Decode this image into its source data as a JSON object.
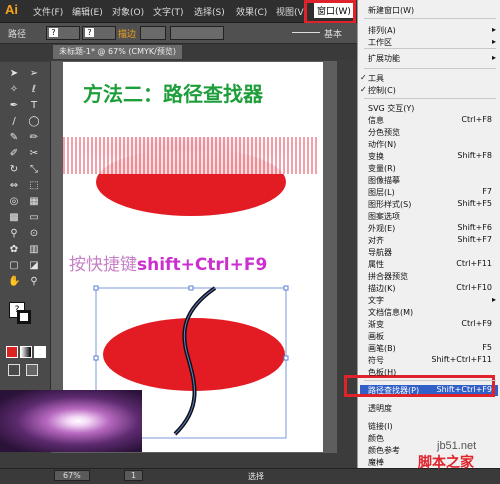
{
  "app": {
    "logo": "Ai"
  },
  "menubar": {
    "items": [
      "文件(F)",
      "编辑(E)",
      "对象(O)",
      "文字(T)",
      "选择(S)",
      "效果(C)",
      "视图(V)",
      "窗口(W)"
    ],
    "active": "窗口(W)"
  },
  "control": {
    "label": "路径",
    "stroke_label": "描边",
    "basic": "基本"
  },
  "document": {
    "tab": "未标题-1* @ 67% (CMYK/预览)"
  },
  "artboard": {
    "title": "方法二：路径查找器",
    "shortcut_cn": "按快捷键",
    "shortcut_key": "shift+Ctrl+F9"
  },
  "statusbar": {
    "zoom": "67%",
    "page": "1",
    "mode": "选择"
  },
  "watermark": {
    "site": "jb51.net",
    "name": "脚本之家"
  },
  "colors": {
    "accent_red": "#e0222a",
    "title_green": "#1e9e3a",
    "shortcut_magenta": "#cc2fd0",
    "highlight": "#3160c8"
  },
  "window_menu": {
    "items": [
      {
        "label": "新建窗口(W)",
        "shortcut": "",
        "arrow": false,
        "check": false
      },
      {
        "label": "排列(A)",
        "shortcut": "",
        "arrow": true,
        "check": false
      },
      {
        "label": "工作区",
        "shortcut": "",
        "arrow": true,
        "check": false
      },
      {
        "label": "扩展功能",
        "shortcut": "",
        "arrow": true,
        "check": false
      },
      {
        "label": "工具",
        "shortcut": "",
        "arrow": false,
        "check": true
      },
      {
        "label": "控制(C)",
        "shortcut": "",
        "arrow": false,
        "check": true
      },
      {
        "label": "SVG 交互(Y)",
        "shortcut": "",
        "arrow": false,
        "check": false
      },
      {
        "label": "信息",
        "shortcut": "Ctrl+F8",
        "arrow": false,
        "check": false
      },
      {
        "label": "分色预览",
        "shortcut": "",
        "arrow": false,
        "check": false
      },
      {
        "label": "动作(N)",
        "shortcut": "",
        "arrow": false,
        "check": false
      },
      {
        "label": "变换",
        "shortcut": "Shift+F8",
        "arrow": false,
        "check": false
      },
      {
        "label": "变量(R)",
        "shortcut": "",
        "arrow": false,
        "check": false
      },
      {
        "label": "图像描摹",
        "shortcut": "",
        "arrow": false,
        "check": false
      },
      {
        "label": "图层(L)",
        "shortcut": "F7",
        "arrow": false,
        "check": false
      },
      {
        "label": "图形样式(S)",
        "shortcut": "Shift+F5",
        "arrow": false,
        "check": false
      },
      {
        "label": "图案选项",
        "shortcut": "",
        "arrow": false,
        "check": false
      },
      {
        "label": "外观(E)",
        "shortcut": "Shift+F6",
        "arrow": false,
        "check": false
      },
      {
        "label": "对齐",
        "shortcut": "Shift+F7",
        "arrow": false,
        "check": false
      },
      {
        "label": "导航器",
        "shortcut": "",
        "arrow": false,
        "check": false
      },
      {
        "label": "属性",
        "shortcut": "Ctrl+F11",
        "arrow": false,
        "check": false
      },
      {
        "label": "拼合器预览",
        "shortcut": "",
        "arrow": false,
        "check": false
      },
      {
        "label": "描边(K)",
        "shortcut": "Ctrl+F10",
        "arrow": false,
        "check": false
      },
      {
        "label": "文字",
        "shortcut": "",
        "arrow": true,
        "check": false
      },
      {
        "label": "文档信息(M)",
        "shortcut": "",
        "arrow": false,
        "check": false
      },
      {
        "label": "渐变",
        "shortcut": "Ctrl+F9",
        "arrow": false,
        "check": false
      },
      {
        "label": "画板",
        "shortcut": "",
        "arrow": false,
        "check": false
      },
      {
        "label": "画笔(B)",
        "shortcut": "F5",
        "arrow": false,
        "check": false
      },
      {
        "label": "符号",
        "shortcut": "Shift+Ctrl+F11",
        "arrow": false,
        "check": false
      },
      {
        "label": "色板(H)",
        "shortcut": "",
        "arrow": false,
        "check": false
      },
      {
        "label": "路径查找器(P)",
        "shortcut": "Shift+Ctrl+F9",
        "arrow": false,
        "check": false
      },
      {
        "label": "透明度",
        "shortcut": "",
        "arrow": false,
        "check": false
      },
      {
        "label": "链接(I)",
        "shortcut": "",
        "arrow": false,
        "check": false
      },
      {
        "label": "颜色",
        "shortcut": "",
        "arrow": false,
        "check": false
      },
      {
        "label": "颜色参考",
        "shortcut": "",
        "arrow": false,
        "check": false
      },
      {
        "label": "魔棒",
        "shortcut": "",
        "arrow": false,
        "check": false
      }
    ]
  }
}
